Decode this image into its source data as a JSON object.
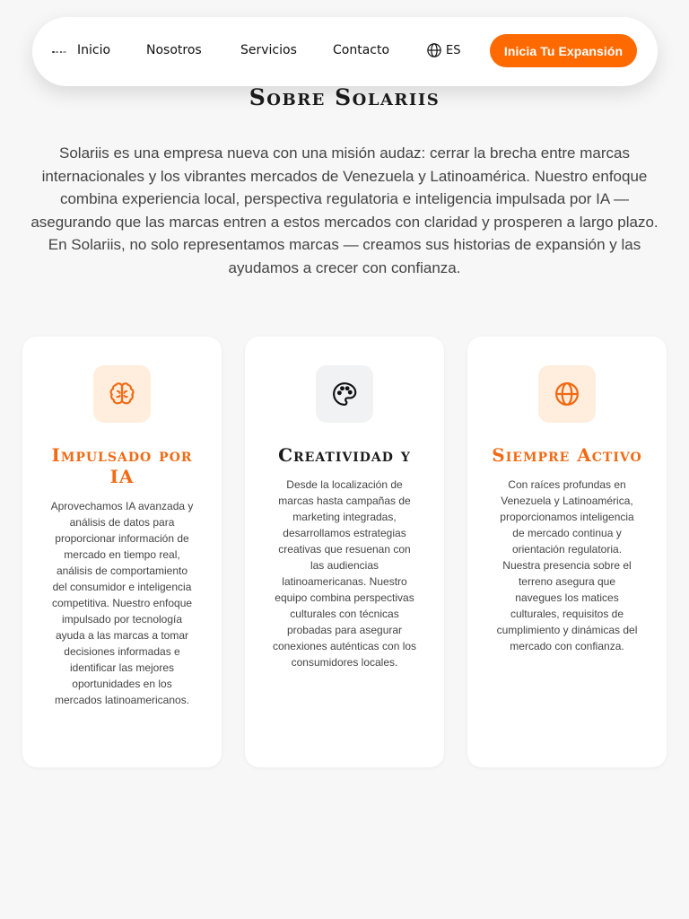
{
  "nav": {
    "links": [
      "Inicio",
      "Nosotros",
      "Servicios",
      "Contacto"
    ],
    "language": "ES",
    "cta": "Inicia Tu Expansión"
  },
  "about": {
    "title": "Sobre Solariis",
    "text": "Solariis es una empresa nueva con una misión audaz: cerrar la brecha entre marcas internacionales y los vibrantes mercados de Venezuela y Latinoamérica. Nuestro enfoque combina experiencia local, perspectiva regulatoria e inteligencia impulsada por IA — asegurando que las marcas entren a estos mercados con claridad y prosperen a largo plazo. En Solariis, no solo representamos marcas — creamos sus historias de expansión y las ayudamos a crecer con confianza."
  },
  "cards": [
    {
      "icon": "brain-icon",
      "title": "Impulsado por IA",
      "text": "Aprovechamos IA avanzada y análisis de datos para proporcionar información de mercado en tiempo real, análisis de comportamiento del consumidor e inteligencia competitiva. Nuestro enfoque impulsado por tecnología ayuda a las marcas a tomar decisiones informadas e identificar las mejores oportunidades en los mercados latinoamericanos."
    },
    {
      "icon": "palette-icon",
      "title": "Creatividad y",
      "text": "Desde la localización de marcas hasta campañas de marketing integradas, desarrollamos estrategias creativas que resuenan con las audiencias latinoamericanas. Nuestro equipo combina perspectivas culturales con técnicas probadas para asegurar conexiones auténticas con los consumidores locales."
    },
    {
      "icon": "globe-icon",
      "title": "Siempre Activo",
      "text": "Con raíces profundas en Venezuela y Latinoamérica, proporcionamos inteligencia de mercado continua y orientación regulatoria. Nuestra presencia sobre el terreno asegura que navegues los matices culturales, requisitos de cumplimiento y dinámicas del mercado con confianza."
    }
  ],
  "colors": {
    "accent": "#ff6a00",
    "accent_text": "#f26a13",
    "background": "#f7f7f7"
  }
}
